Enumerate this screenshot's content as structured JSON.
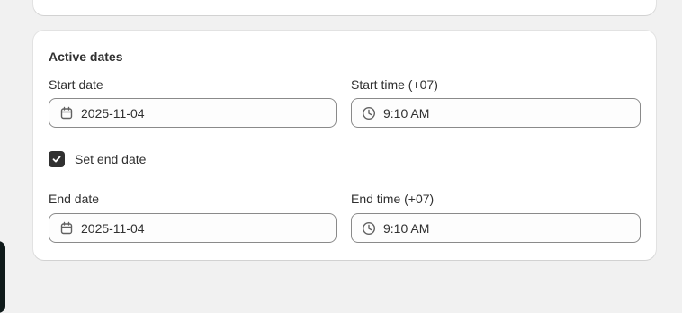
{
  "card": {
    "title": "Active dates"
  },
  "start": {
    "date_label": "Start date",
    "date_value": "2025-11-04",
    "time_label": "Start time (+07)",
    "time_value": "9:10 AM"
  },
  "end_toggle": {
    "label": "Set end date",
    "checked": true
  },
  "end": {
    "date_label": "End date",
    "date_value": "2025-11-04",
    "time_label": "End time (+07)",
    "time_value": "9:10 AM"
  },
  "icons": {
    "date": "calendar-icon",
    "time": "clock-icon",
    "check": "checkmark-icon"
  }
}
